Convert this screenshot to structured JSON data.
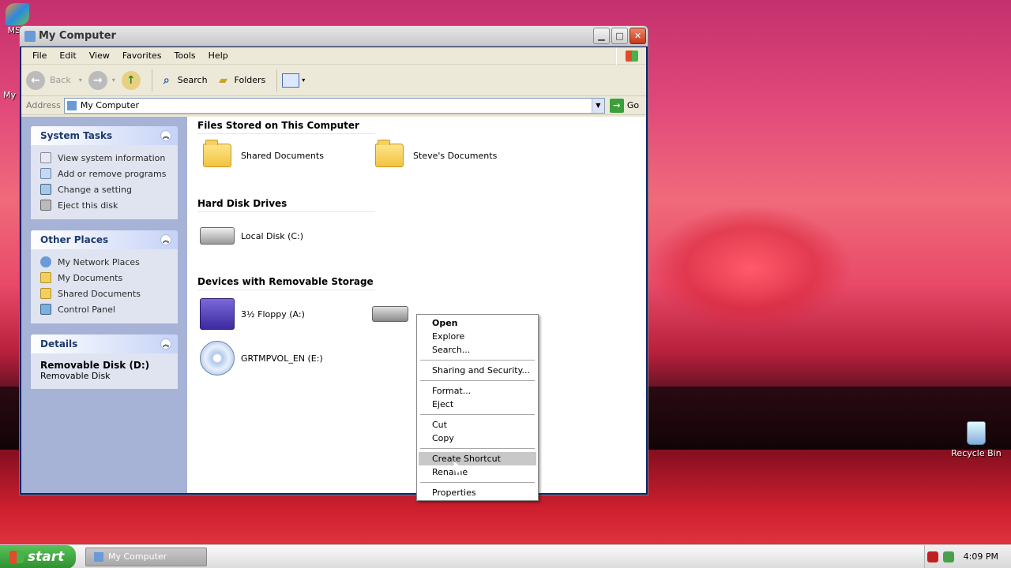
{
  "window": {
    "title": "My Computer"
  },
  "menu": [
    "File",
    "Edit",
    "View",
    "Favorites",
    "Tools",
    "Help"
  ],
  "toolbar": {
    "back": "Back",
    "search": "Search",
    "folders": "Folders"
  },
  "address": {
    "label": "Address",
    "value": "My Computer",
    "go": "Go"
  },
  "sidebar": {
    "system_tasks": {
      "title": "System Tasks",
      "items": [
        "View system information",
        "Add or remove programs",
        "Change a setting",
        "Eject this disk"
      ]
    },
    "other_places": {
      "title": "Other Places",
      "items": [
        "My Network Places",
        "My Documents",
        "Shared Documents",
        "Control Panel"
      ]
    },
    "details": {
      "title": "Details",
      "name": "Removable Disk (D:)",
      "type": "Removable Disk"
    }
  },
  "groups": {
    "files": {
      "title": "Files Stored on This Computer",
      "items": [
        "Shared Documents",
        "Steve's Documents"
      ]
    },
    "hdd": {
      "title": "Hard Disk Drives",
      "items": [
        "Local Disk (C:)"
      ]
    },
    "removable": {
      "title": "Devices with Removable Storage",
      "items": [
        "3½ Floppy (A:)",
        "GRTMPVOL_EN (E:)"
      ]
    }
  },
  "context_menu": {
    "items": [
      "Open",
      "Explore",
      "Search...",
      "Sharing and Security...",
      "Format...",
      "Eject",
      "Cut",
      "Copy",
      "Create Shortcut",
      "Rename",
      "Properties"
    ]
  },
  "desktop": {
    "recycle_bin": "Recycle Bin",
    "msn": "MSN",
    "my": "My"
  },
  "taskbar": {
    "start": "start",
    "task": "My Computer",
    "clock": "4:09 PM"
  }
}
